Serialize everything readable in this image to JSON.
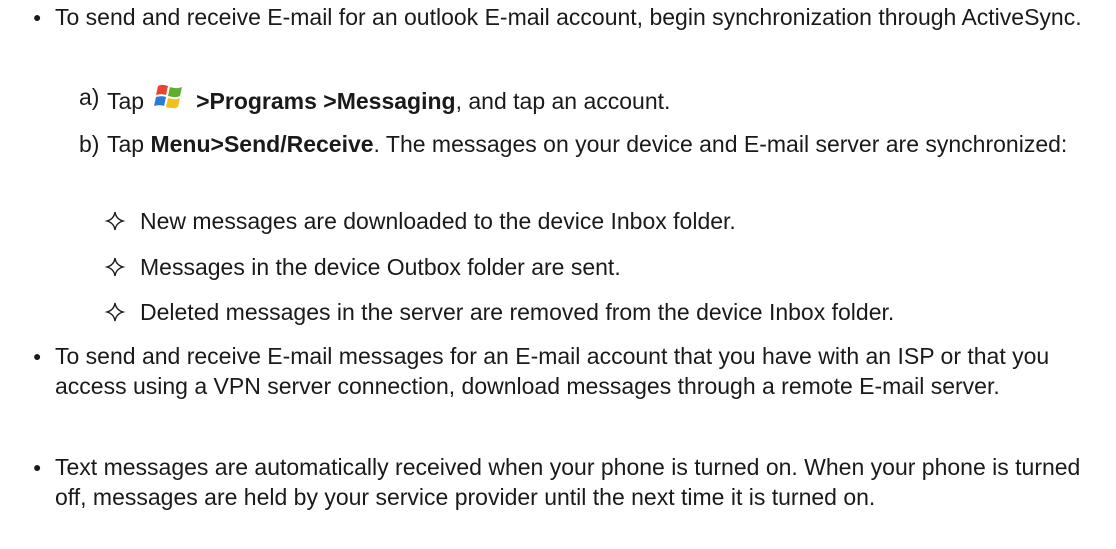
{
  "bullets": {
    "b1": {
      "text": "To send and receive E-mail for an outlook E-mail account, begin synchronization through ActiveSync."
    },
    "b2": {
      "text": "To send and receive E-mail messages for an E-mail account that you have with an ISP or that you access using a VPN server connection, download messages through a remote E-mail server."
    },
    "b3": {
      "text": "Text messages are automatically received when your phone is turned on. When your phone is turned off, messages are held by your service provider until the next time it is turned on."
    }
  },
  "steps": {
    "a": {
      "marker": "a)",
      "tap": "Tap",
      "path": ">Programs >Messaging",
      "rest": ", and tap an account.",
      "icon": "windows-start-icon"
    },
    "b": {
      "marker": "b)",
      "tap": "Tap ",
      "path": "Menu>Send/Receive",
      "rest": ". The messages on your device and E-mail server are synchronized:"
    }
  },
  "sync_results": {
    "r1": "New messages are downloaded to the device Inbox folder.",
    "r2": "Messages in the device Outbox folder are sent.",
    "r3": "Deleted messages in the server are removed from the device Inbox folder."
  },
  "colors": {
    "text": "#1a1a1a",
    "logo_red": "#e8452c",
    "logo_green": "#5fae2e",
    "logo_blue": "#2a7ad6",
    "logo_yellow": "#f2c01e"
  }
}
